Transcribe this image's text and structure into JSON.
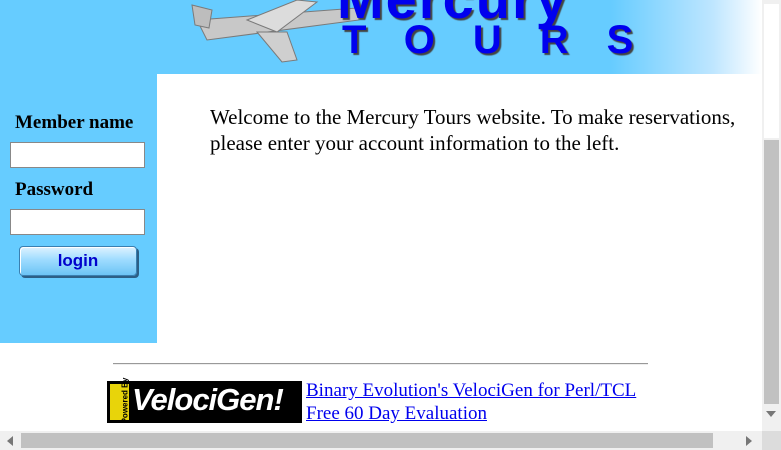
{
  "banner": {
    "brand_top": "Mercury",
    "brand_bottom": "TOURS",
    "brand_color": "#0000ee"
  },
  "login": {
    "member_label": "Member name",
    "password_label": "Password",
    "member_value": "",
    "password_value": "",
    "button_label": "login",
    "panel_color": "#66ccff"
  },
  "main": {
    "welcome_text": "Welcome to the Mercury Tours website. To make reservations, please enter your account information to the left."
  },
  "footer": {
    "logo_text": "VelociGen!",
    "logo_tab_text": "Powered By",
    "link_line1": "Binary Evolution's VelociGen for Perl/TCL",
    "link_line2": "Free 60 Day Evaluation"
  },
  "icons": {
    "banner_graphic": "airplane-icon",
    "scroll_left": "arrow-left-icon",
    "scroll_right": "arrow-right-icon",
    "scroll_down": "arrow-down-icon"
  }
}
